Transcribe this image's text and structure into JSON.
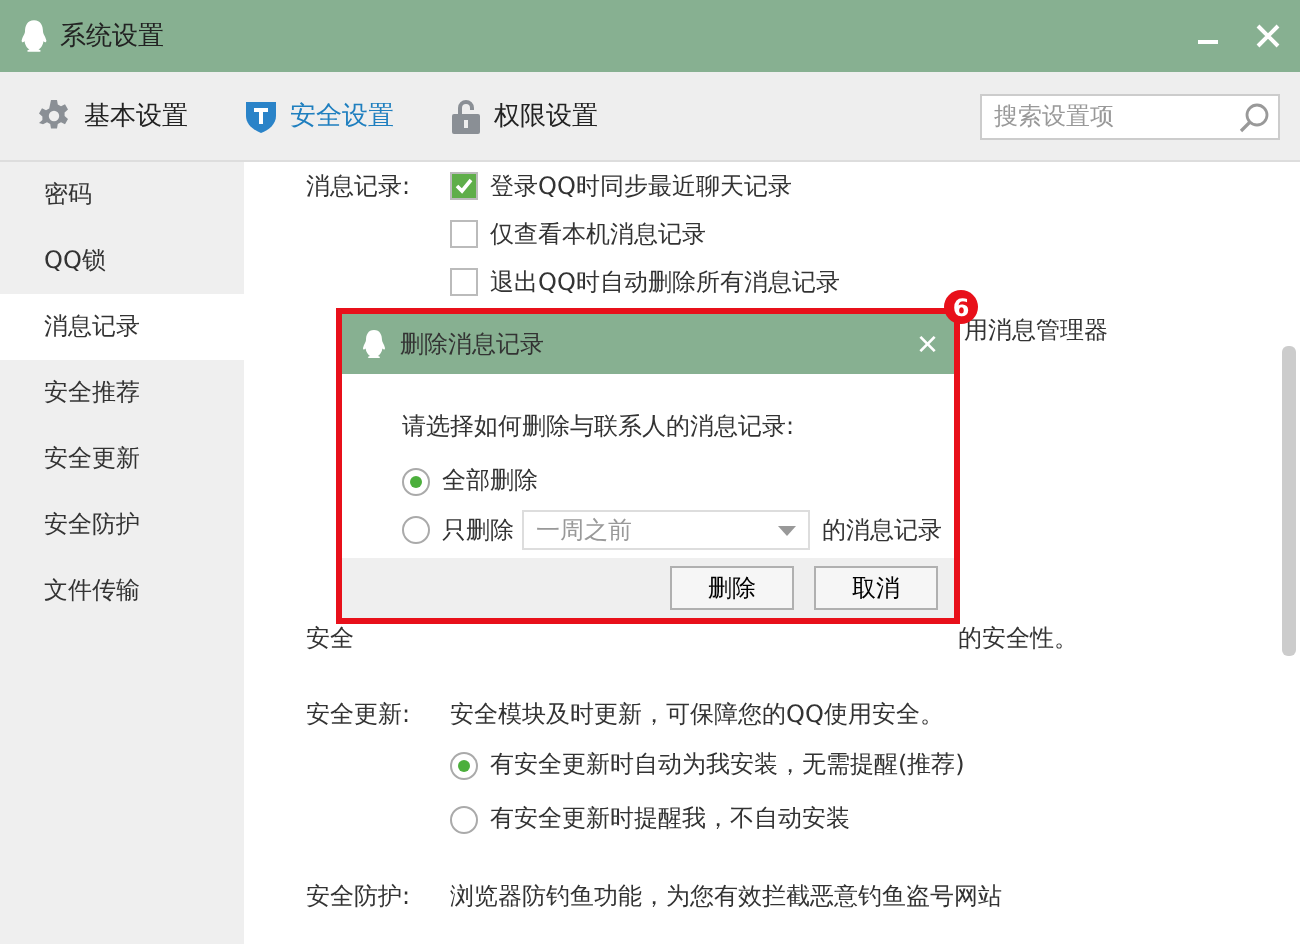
{
  "window": {
    "title": "系统设置"
  },
  "tabs": [
    {
      "label": "基本设置",
      "selected": false
    },
    {
      "label": "安全设置",
      "selected": true
    },
    {
      "label": "权限设置",
      "selected": false
    }
  ],
  "search": {
    "placeholder": "搜索设置项"
  },
  "sidebar": {
    "items": [
      {
        "label": "密码",
        "selected": false
      },
      {
        "label": "QQ锁",
        "selected": false
      },
      {
        "label": "消息记录",
        "selected": true
      },
      {
        "label": "安全推荐",
        "selected": false
      },
      {
        "label": "安全更新",
        "selected": false
      },
      {
        "label": "安全防护",
        "selected": false
      },
      {
        "label": "文件传输",
        "selected": false
      }
    ]
  },
  "message_records": {
    "label": "消息记录:",
    "options": [
      {
        "label": "登录QQ时同步最近聊天记录",
        "checked": true
      },
      {
        "label": "仅查看本机消息记录",
        "checked": false
      },
      {
        "label": "退出QQ时自动删除所有消息记录",
        "checked": false
      }
    ],
    "partial_text": "用消息管理器"
  },
  "security_recommend": {
    "label": "安全",
    "partial_text": "的安全性。"
  },
  "security_update": {
    "label": "安全更新:",
    "description": "安全模块及时更新，可保障您的QQ使用安全。",
    "options": [
      {
        "label": "有安全更新时自动为我安装，无需提醒(推荐)",
        "selected": true
      },
      {
        "label": "有安全更新时提醒我，不自动安装",
        "selected": false
      }
    ]
  },
  "security_protection": {
    "label": "安全防护:",
    "description": "浏览器防钓鱼功能，为您有效拦截恶意钓鱼盗号网站"
  },
  "dialog": {
    "title": "删除消息记录",
    "close": "×",
    "callout": "6",
    "prompt": "请选择如何删除与联系人的消息记录:",
    "options": [
      {
        "label": "全部删除",
        "selected": true
      },
      {
        "label": "只删除",
        "selected": false
      }
    ],
    "range": {
      "value": "一周之前"
    },
    "suffix": "的消息记录",
    "buttons": [
      {
        "label": "删除"
      },
      {
        "label": "取消"
      }
    ]
  }
}
